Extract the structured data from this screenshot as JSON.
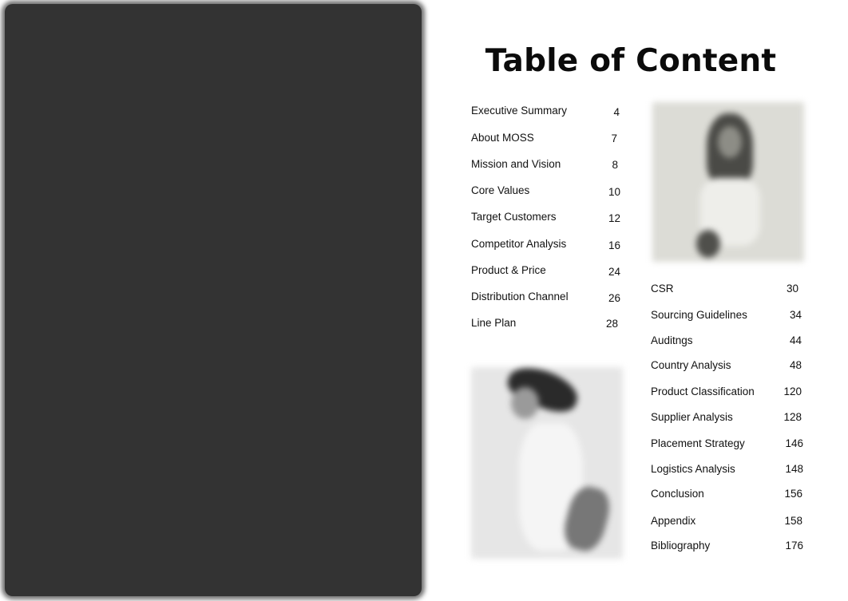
{
  "page": {
    "title": "Table of Content"
  },
  "toc_left": [
    {
      "label": "Executive Summary",
      "page": "4"
    },
    {
      "label": "About MOSS",
      "page": "7"
    },
    {
      "label": "Mission and Vision",
      "page": "8"
    },
    {
      "label": "Core Values",
      "page": "10"
    },
    {
      "label": "Target Customers",
      "page": "12"
    },
    {
      "label": "Competitor Analysis",
      "page": "16"
    },
    {
      "label": "Product & Price",
      "page": "24"
    },
    {
      "label": "Distribution Channel",
      "page": "26"
    },
    {
      "label": "Line Plan",
      "page": "28"
    }
  ],
  "toc_right": [
    {
      "label": "CSR",
      "page": "30"
    },
    {
      "label": "Sourcing Guidelines",
      "page": "34"
    },
    {
      "label": "Auditngs",
      "page": "44"
    },
    {
      "label": "Country Analysis",
      "page": "48"
    },
    {
      "label": "Product Classification",
      "page": "120"
    },
    {
      "label": "Supplier Analysis",
      "page": "128"
    },
    {
      "label": "Placement Strategy",
      "page": "146"
    },
    {
      "label": "Logistics Analysis",
      "page": "148"
    },
    {
      "label": "Conclusion",
      "page": "156"
    },
    {
      "label": "Appendix",
      "page": "158"
    },
    {
      "label": "Bibliography",
      "page": "176"
    }
  ],
  "images": {
    "photo_1": "model-photo-dark-hair",
    "photo_2": "model-photo-hat"
  }
}
